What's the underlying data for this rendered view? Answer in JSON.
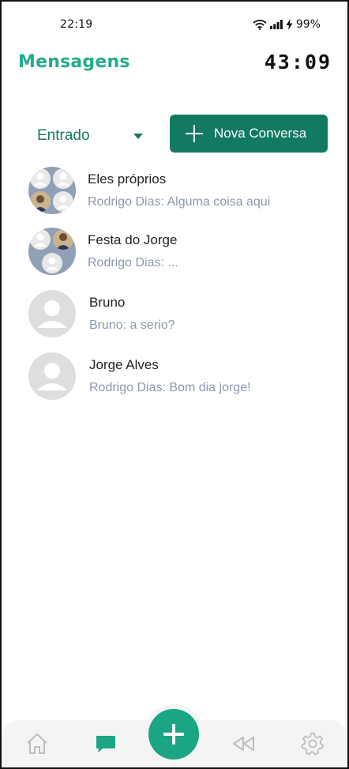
{
  "status_bar": {
    "time": "22:19",
    "battery": "99%",
    "icons": [
      "wifi-icon",
      "signal-icon",
      "charging-icon"
    ]
  },
  "header": {
    "title": "Mensagens",
    "timer": "43:09"
  },
  "controls": {
    "filter_selected": "Entrado",
    "new_conversation_label": "Nova Conversa"
  },
  "conversations": [
    {
      "name": "Eles próprios",
      "preview": "Rodrigo Dias: Alguma coisa aqui",
      "avatar": "group-avatar"
    },
    {
      "name": "Festa do Jorge",
      "preview": "Rodrigo Dias: ...",
      "avatar": "group-avatar"
    },
    {
      "name": "Bruno",
      "preview": "Bruno: a serio?",
      "avatar": "user-avatar"
    },
    {
      "name": "Jorge Alves",
      "preview": "Rodrigo Dias: Bom dia jorge!",
      "avatar": "user-avatar"
    }
  ],
  "bottom_nav": {
    "items": [
      "home-icon",
      "chat-icon",
      "add-icon",
      "rewind-icon",
      "settings-icon"
    ],
    "active": "chat-icon"
  },
  "colors": {
    "accent": "#21ad8b",
    "button": "#127a60",
    "fab": "#1aa584",
    "preview_text": "#8b98ad"
  }
}
